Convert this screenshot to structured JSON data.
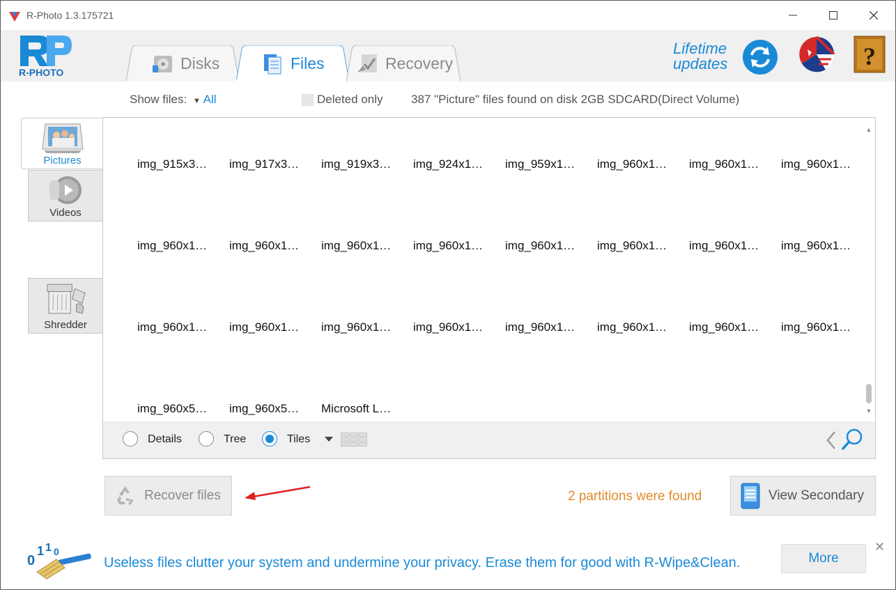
{
  "window": {
    "title": "R-Photo 1.3.175721"
  },
  "logo": {
    "text": "R-PHOTO"
  },
  "tabs": [
    {
      "label": "Disks",
      "active": false,
      "icon": "disk-icon"
    },
    {
      "label": "Files",
      "active": true,
      "icon": "files-icon"
    },
    {
      "label": "Recovery",
      "active": false,
      "icon": "recovery-icon"
    }
  ],
  "header": {
    "lifetime_line1": "Lifetime",
    "lifetime_line2": "updates"
  },
  "filter": {
    "show_files_label": "Show files:",
    "show_files_value": "All",
    "deleted_only_label": "Deleted only",
    "found_text": "387 \"Picture\" files found on disk 2GB SDCARD(Direct Volume)"
  },
  "side_tabs": [
    {
      "label": "Pictures",
      "active": true
    },
    {
      "label": "Videos",
      "active": false
    },
    {
      "label": "Shredder",
      "active": false
    }
  ],
  "files": [
    [
      "img_915x3…",
      "img_917x3…",
      "img_919x3…",
      "img_924x1…",
      "img_959x1…",
      "img_960x1…",
      "img_960x1…",
      "img_960x1…"
    ],
    [
      "img_960x1…",
      "img_960x1…",
      "img_960x1…",
      "img_960x1…",
      "img_960x1…",
      "img_960x1…",
      "img_960x1…",
      "img_960x1…"
    ],
    [
      "img_960x1…",
      "img_960x1…",
      "img_960x1…",
      "img_960x1…",
      "img_960x1…",
      "img_960x1…",
      "img_960x1…",
      "img_960x1…"
    ],
    [
      "img_960x5…",
      "img_960x5…",
      "Microsoft L…"
    ]
  ],
  "view_modes": {
    "details": "Details",
    "tree": "Tree",
    "tiles": "Tiles",
    "selected": "tiles"
  },
  "actions": {
    "recover_label": "Recover files",
    "partitions_text": "2 partitions were found",
    "view_secondary_label": "View Secondary"
  },
  "ad": {
    "text": "Useless files clutter your system and undermine your privacy. Erase them for good with R-Wipe&Clean.",
    "more_label": "More",
    "close_glyph": "✕"
  },
  "colors": {
    "accent": "#1a8ad6",
    "partitions": "#e08b2b",
    "annotation_arrow": "#e02020"
  }
}
